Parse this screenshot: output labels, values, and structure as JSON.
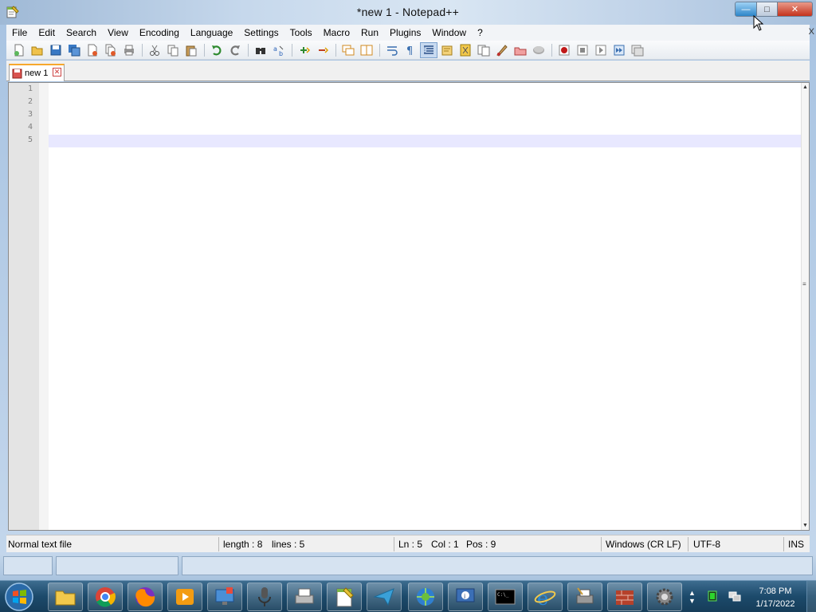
{
  "window": {
    "title": "*new 1 - Notepad++",
    "caption": {
      "minimize": "—",
      "maximize": "□",
      "close": "✕"
    }
  },
  "menu": {
    "items": [
      "File",
      "Edit",
      "Search",
      "View",
      "Encoding",
      "Language",
      "Settings",
      "Tools",
      "Macro",
      "Run",
      "Plugins",
      "Window",
      "?"
    ],
    "close_glyph": "X"
  },
  "toolbar": {
    "icons": [
      "new-file-icon",
      "open-file-icon",
      "save-icon",
      "save-all-icon",
      "close-icon",
      "close-all-icon",
      "print-icon",
      "cut-icon",
      "copy-icon",
      "paste-icon",
      "undo-icon",
      "redo-icon",
      "find-icon",
      "replace-icon",
      "zoom-in-icon",
      "zoom-out-icon",
      "sync-vertical-icon",
      "sync-horizontal-icon",
      "word-wrap-icon",
      "show-all-characters-icon",
      "indent-guide-icon",
      "user-defined-language-icon",
      "document-map-icon",
      "function-list-icon",
      "folder-as-workspace-icon",
      "monitoring-icon",
      "record-macro-icon",
      "stop-recording-icon",
      "playback-icon",
      "run-macro-multiple-icon",
      "save-macro-icon"
    ]
  },
  "tabs": [
    {
      "label": "new 1",
      "modified": true
    }
  ],
  "editor": {
    "line_numbers": [
      "1",
      "2",
      "3",
      "4",
      "5"
    ],
    "current_line": 5
  },
  "status": {
    "file_type": "Normal text file",
    "length": "length : 8",
    "lines": "lines : 5",
    "ln": "Ln : 5",
    "col": "Col : 1",
    "pos": "Pos : 9",
    "eol": "Windows (CR LF)",
    "encoding": "UTF-8",
    "mode": "INS"
  },
  "taskbar": {
    "apps": [
      "file-explorer",
      "chrome",
      "firefox",
      "media-player",
      "remote-desktop",
      "microphone",
      "fax-printer",
      "notepad-plus-plus",
      "send-arrow",
      "network-settings",
      "system-info",
      "command-prompt",
      "internet-explorer",
      "printer-tool",
      "firewall",
      "settings-gear"
    ],
    "clock": {
      "time": "7:08 PM",
      "date": "1/17/2022"
    }
  },
  "colors": {
    "current_line": "#e8e8ff",
    "tab_accent": "#f7a82c",
    "taskbar": "#1c4a6b"
  }
}
